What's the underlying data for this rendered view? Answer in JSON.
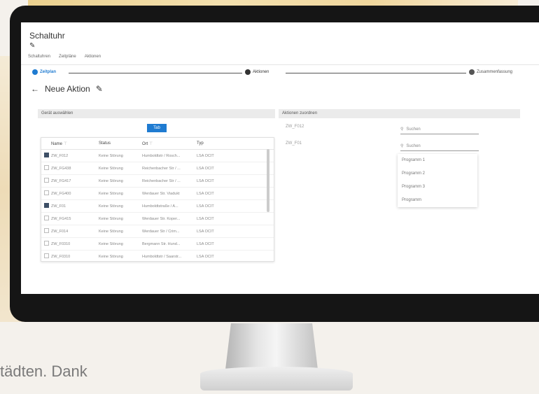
{
  "app": {
    "title": "Schaltuhr"
  },
  "menu": [
    "Schaltuhren",
    "Zeitpläne",
    "Aktionen"
  ],
  "stepper": {
    "steps": [
      {
        "label": "Zeitplan",
        "color": "#1f7bd1"
      },
      {
        "label": "Aktionen",
        "color": "#333333"
      },
      {
        "label": "Zusammenfassung",
        "color": "#555555"
      }
    ]
  },
  "page": {
    "title": "Neue Aktion"
  },
  "left_panel": {
    "title": "Gerät auswählen",
    "button": "Tab",
    "columns": [
      "Name",
      "Status",
      "Ort",
      "Typ"
    ],
    "rows": [
      {
        "checked": true,
        "name": "ZW_F012",
        "status": "Keine Störung",
        "ort": "Humboldtstr / Rosch...",
        "typ": "LSA OCIT"
      },
      {
        "checked": false,
        "name": "ZW_FG438",
        "status": "Keine Störung",
        "ort": "Reichenbacher Str / ...",
        "typ": "LSA OCIT"
      },
      {
        "checked": false,
        "name": "ZW_FG417",
        "status": "Keine Störung",
        "ort": "Reichenbacher Str / ...",
        "typ": "LSA OCIT"
      },
      {
        "checked": false,
        "name": "ZW_FG400",
        "status": "Keine Störung",
        "ort": "Werdauer Str. Viadukt",
        "typ": "LSA OCIT"
      },
      {
        "checked": true,
        "name": "ZW_F01",
        "status": "Keine Störung",
        "ort": "Humboldtstraße / A...",
        "typ": "LSA OCIT"
      },
      {
        "checked": false,
        "name": "ZW_FG415",
        "status": "Keine Störung",
        "ort": "Werdauer Str. Koper...",
        "typ": "LSA OCIT"
      },
      {
        "checked": false,
        "name": "ZW_F014",
        "status": "Keine Störung",
        "ort": "Werdauer Str / Crim...",
        "typ": "LSA OCIT"
      },
      {
        "checked": false,
        "name": "ZW_F0310",
        "status": "Keine Störung",
        "ort": "Bergmann Str. Hund...",
        "typ": "LSA OCIT"
      },
      {
        "checked": false,
        "name": "ZW_F0310",
        "status": "Keine Störung",
        "ort": "Humboldtstr / Saarstr...",
        "typ": "LSA OCIT"
      }
    ]
  },
  "right_panel": {
    "title": "Aktionen zuordnen",
    "devices": [
      "ZW_F012",
      "ZW_F01"
    ],
    "search_placeholder": "Suchen",
    "options": [
      "Programm 1",
      "Programm 2",
      "Programm 3",
      "Programm"
    ]
  },
  "caption": "tädten. Dank"
}
